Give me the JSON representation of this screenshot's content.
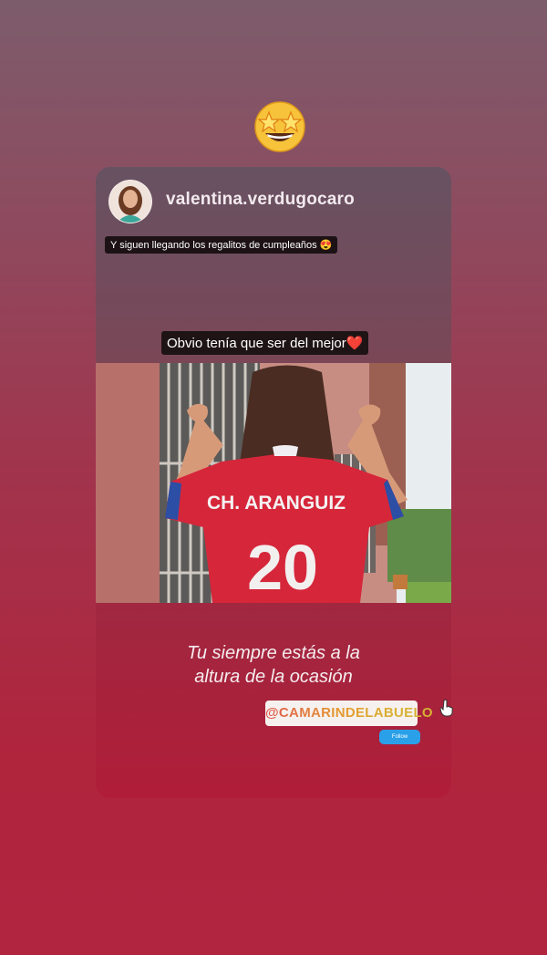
{
  "story": {
    "sticker_icon": "star-struck-emoji-icon",
    "quote_lines": [
      "Tu siempre estás a la",
      "altura de la ocasión"
    ],
    "mention": "@CAMARINDELABUELO",
    "follow_label": "Follow",
    "cursor_icon": "hand-pointer-icon"
  },
  "shared_post": {
    "username": "valentina.verdugocaro",
    "caption_small": "Y siguen llegando los regalitos de cumpleaños 😍",
    "caption_main": "Obvio tenía que ser del mejor❤️",
    "jersey_name": "CH. ARANGUIZ",
    "jersey_number": "20"
  },
  "colors": {
    "background_top": "#7c5c6b",
    "background_bottom": "#b22540",
    "jersey_red": "#d6263a",
    "follow_blue": "#2aa0e8"
  }
}
